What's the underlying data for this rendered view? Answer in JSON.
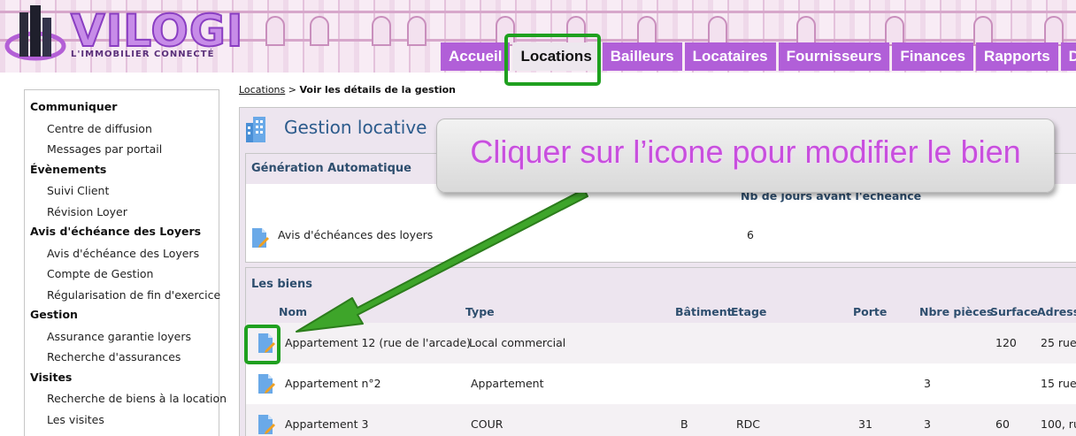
{
  "brand": {
    "name": "VILOGI",
    "tagline": "L'IMMOBILIER CONNECTÉ"
  },
  "nav": {
    "tabs": [
      {
        "label": "Accueil",
        "active": false
      },
      {
        "label": "Locations",
        "active": true
      },
      {
        "label": "Bailleurs",
        "active": false
      },
      {
        "label": "Locataires",
        "active": false
      },
      {
        "label": "Fournisseurs",
        "active": false
      },
      {
        "label": "Finances",
        "active": false
      },
      {
        "label": "Rapports",
        "active": false
      },
      {
        "label": "De",
        "active": false
      }
    ]
  },
  "sidebar": {
    "sections": [
      {
        "title": "Communiquer",
        "items": [
          "Centre de diffusion",
          "Messages par portail"
        ]
      },
      {
        "title": "Évènements",
        "items": [
          "Suivi Client",
          "Révision Loyer"
        ]
      },
      {
        "title": "Avis d'échéance des Loyers",
        "items": [
          "Avis d'échéance des Loyers",
          "Compte de Gestion",
          "Régularisation de fin d'exercice"
        ]
      },
      {
        "title": "Gestion",
        "items": [
          "Assurance garantie loyers",
          "Recherche d'assurances"
        ]
      },
      {
        "title": "Visites",
        "items": [
          "Recherche de biens à la location",
          "Les visites"
        ]
      }
    ]
  },
  "breadcrumb": {
    "link": "Locations",
    "separator": ">",
    "current": "Voir les détails de la gestion"
  },
  "panel": {
    "title": "Gestion locative"
  },
  "generation": {
    "title": "Génération Automatique",
    "column_header": "Nb de jours avant l'échéance",
    "row": {
      "label": "Avis d'échéances des loyers",
      "value": "6"
    }
  },
  "biens": {
    "title": "Les biens",
    "columns": [
      "Nom",
      "Type",
      "Bâtiment",
      "Etage",
      "Porte",
      "Nbre pièces",
      "Surface",
      "Adresse"
    ],
    "rows": [
      {
        "nom": "Appartement 12 (rue de l'arcade)",
        "type": "Local commercial",
        "batiment": "",
        "etage": "",
        "porte": "",
        "pieces": "",
        "surface": "120",
        "adresse": "25 rue"
      },
      {
        "nom": "Appartement n°2",
        "type": "Appartement",
        "batiment": "",
        "etage": "",
        "porte": "",
        "pieces": "3",
        "surface": "",
        "adresse": "15 rue"
      },
      {
        "nom": "Appartement 3",
        "type": "COUR",
        "batiment": "B",
        "etage": "RDC",
        "porte": "31",
        "pieces": "3",
        "surface": "60",
        "adresse": "100, ru"
      }
    ]
  },
  "annotation": {
    "text": "Cliquer sur l’icone pour modifier le bien",
    "highlight_color": "#1fa01f",
    "text_color": "#c84fde"
  },
  "colors": {
    "nav_tab": "#b15fd8",
    "panel_title": "#2c5b8c",
    "header_text": "#2e4e6e"
  }
}
